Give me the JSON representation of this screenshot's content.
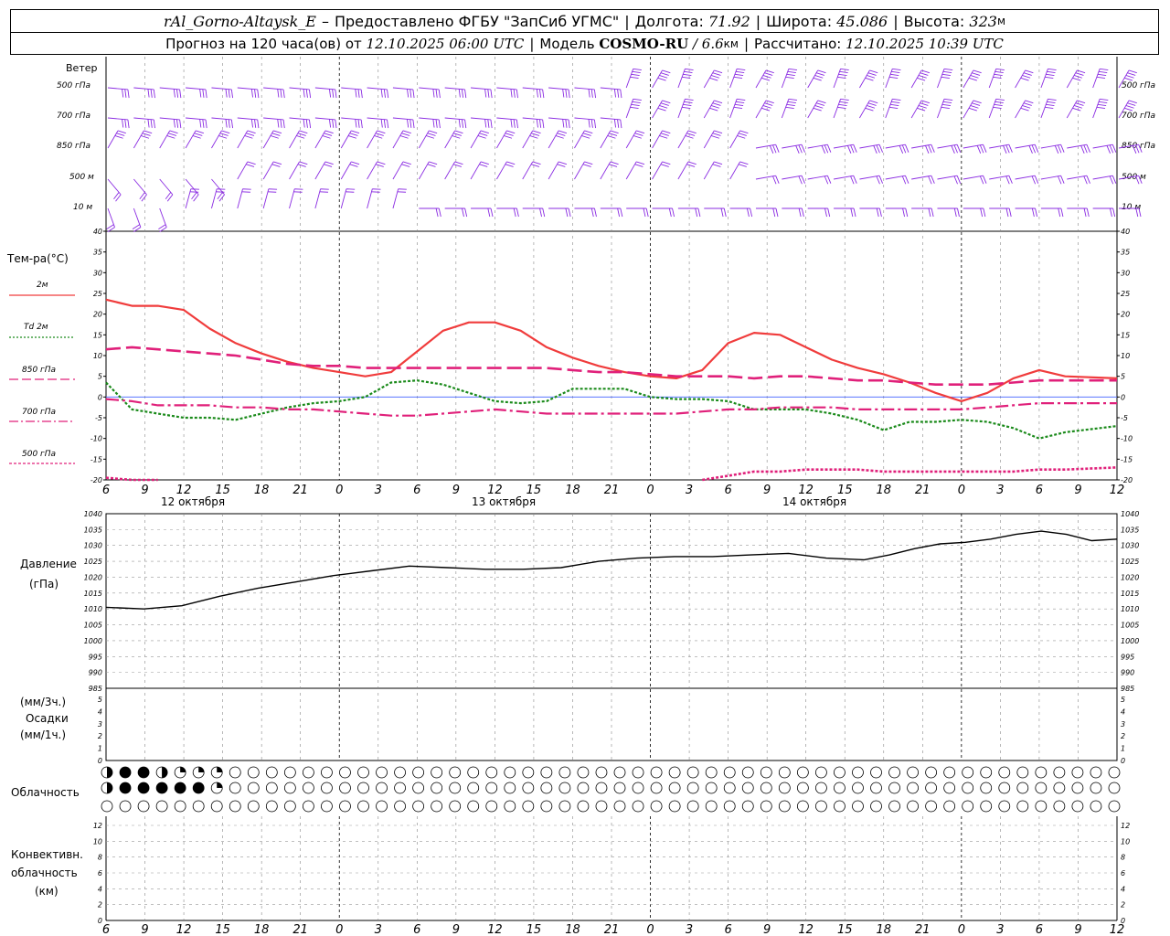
{
  "header": {
    "station": "rAl_Gorno-Altaysk_E",
    "dash": "–",
    "provided_by": "Предоставлено ФГБУ \"ЗапСиб УГМС\"",
    "lon_label": "Долгота:",
    "lon_value": "71.92",
    "lat_label": "Широта:",
    "lat_value": "45.086",
    "alt_label": "Высота:",
    "alt_value": "323",
    "alt_unit": "м",
    "forecast_label": "Прогноз на 120 часа(ов) от",
    "forecast_from": "12.10.2025 06:00 UTC",
    "model_label": "Модель",
    "model_name": "COSMO-RU",
    "model_res": "/ 6.6",
    "model_res_unit": "км",
    "calc_label": "Рассчитано:",
    "calc_value": "12.10.2025 10:39 UTC"
  },
  "wind_panel": {
    "title": "Ветер",
    "levels": [
      "500 гПа",
      "700 гПа",
      "850 гПа",
      "500 м",
      "10 м"
    ],
    "barb_color": "#8a2be2"
  },
  "temp_panel": {
    "title": "Тем-ра(°С)",
    "legend": [
      {
        "label": "2м",
        "color": "#f03c3c",
        "style": "solid"
      },
      {
        "label": "Td 2м",
        "color": "#1a8a1a",
        "style": "dotted"
      },
      {
        "label": "850 гПа",
        "color": "#e0207a",
        "style": "dashed"
      },
      {
        "label": "700 гПа",
        "color": "#e0207a",
        "style": "dashdot"
      },
      {
        "label": "500 гПа",
        "color": "#e0207a",
        "style": "dense-dashed"
      }
    ],
    "yticks": [
      "40",
      "35",
      "30",
      "25",
      "20",
      "15",
      "10",
      "5",
      "0",
      "-5",
      "-10",
      "-15",
      "-20"
    ]
  },
  "time_axis": {
    "hours": [
      "6",
      "9",
      "12",
      "15",
      "18",
      "21",
      "0",
      "3",
      "6",
      "9",
      "12",
      "15",
      "18",
      "21",
      "0",
      "3",
      "6",
      "9",
      "12",
      "15",
      "18",
      "21",
      "0",
      "3",
      "6",
      "9",
      "12"
    ],
    "dates": [
      "12 октября",
      "13 октября",
      "14 октября"
    ]
  },
  "pressure_panel": {
    "title": "Давление",
    "unit": "(гПа)",
    "yticks": [
      "1040",
      "1035",
      "1030",
      "1025",
      "1020",
      "1015",
      "1010",
      "1005",
      "1000",
      "995",
      "990",
      "985"
    ]
  },
  "precip_panel": {
    "unit3": "(мм/3ч.)",
    "title": "Осадки",
    "unit1": "(мм/1ч.)",
    "yticks": [
      "5",
      "4",
      "3",
      "2",
      "1",
      "0"
    ]
  },
  "cloud_panel": {
    "title": "Облачность",
    "rows": [
      [
        2,
        4,
        4,
        2,
        1,
        1,
        1,
        0,
        0,
        0,
        0,
        0,
        0,
        0,
        0,
        0,
        0,
        0,
        0,
        0,
        0,
        0,
        0,
        0,
        0,
        0,
        0,
        0,
        0,
        0,
        0,
        0,
        0,
        0,
        0,
        0,
        0,
        0,
        0,
        0,
        0,
        0,
        0,
        0,
        0,
        0,
        0,
        0,
        0,
        0,
        0,
        0,
        0,
        0,
        0,
        0
      ],
      [
        2,
        4,
        4,
        4,
        4,
        4,
        1,
        0,
        0,
        0,
        0,
        0,
        0,
        0,
        0,
        0,
        0,
        0,
        0,
        0,
        0,
        0,
        0,
        0,
        0,
        0,
        0,
        0,
        0,
        0,
        0,
        0,
        0,
        0,
        0,
        0,
        0,
        0,
        0,
        0,
        0,
        0,
        0,
        0,
        0,
        0,
        0,
        0,
        0,
        0,
        0,
        0,
        0,
        0,
        0,
        0
      ],
      [
        0,
        0,
        0,
        0,
        0,
        0,
        0,
        0,
        0,
        0,
        0,
        0,
        0,
        0,
        0,
        0,
        0,
        0,
        0,
        0,
        0,
        0,
        0,
        0,
        0,
        0,
        0,
        0,
        0,
        0,
        0,
        0,
        0,
        0,
        0,
        0,
        0,
        0,
        0,
        0,
        0,
        0,
        0,
        0,
        0,
        0,
        0,
        0,
        0,
        0,
        0,
        0,
        0,
        0,
        0,
        0
      ]
    ]
  },
  "conv_panel": {
    "title1": "Конвективн.",
    "title2": "облачность",
    "unit": "(км)",
    "yticks": [
      "12",
      "10",
      "8",
      "6",
      "4",
      "2",
      "0"
    ]
  },
  "chart_data": [
    {
      "type": "line",
      "title": "Тем-ра(°С)",
      "x_hours": [
        0,
        3,
        6,
        9,
        12,
        15,
        18,
        21,
        24,
        27,
        30,
        33,
        36,
        39,
        42,
        45,
        48,
        51,
        54,
        57,
        60,
        63,
        66,
        69,
        72,
        75,
        78
      ],
      "ylim": [
        -20,
        40
      ],
      "series": [
        {
          "name": "2м",
          "values": [
            23.5,
            22,
            22,
            21,
            16.5,
            13,
            10.5,
            8.5,
            7,
            6,
            5,
            6,
            11,
            16,
            18,
            18,
            16,
            12,
            9.5,
            7.5,
            6,
            5,
            4.5,
            6.5,
            13,
            15.5,
            15,
            12,
            9,
            7,
            5.5,
            3.5,
            1,
            -1,
            1,
            4.5,
            6.5,
            5,
            4.5
          ]
        },
        {
          "name": "Td 2м",
          "values": [
            3.5,
            -3,
            -4,
            -5,
            -5,
            -5.5,
            -4,
            -2.5,
            -1.5,
            -1,
            0,
            3.5,
            4,
            3,
            1,
            -1,
            -1.5,
            -1,
            2,
            2,
            2,
            0,
            -0.5,
            -0.5,
            -1,
            -3,
            -3,
            -3,
            -4,
            -5.5,
            -8,
            -6,
            -6,
            -5.5,
            -6,
            -7.5,
            -10,
            -8.5,
            -7
          ]
        },
        {
          "name": "850 гПа",
          "values": [
            11.5,
            12,
            11.5,
            11,
            10.5,
            10,
            9,
            8,
            7.5,
            7.5,
            7,
            7,
            7,
            7,
            7,
            7,
            7,
            7,
            6.5,
            6,
            6,
            5.5,
            5,
            5,
            5,
            4.5,
            5,
            5,
            4.5,
            4,
            4,
            3.5,
            3,
            3,
            3,
            3.5,
            4,
            4,
            4
          ]
        },
        {
          "name": "700 гПа",
          "values": [
            -0.5,
            -1,
            -2,
            -2,
            -2,
            -2.5,
            -2.5,
            -3,
            -3,
            -3.5,
            -4,
            -4.5,
            -4.5,
            -4,
            -3.5,
            -3,
            -3.5,
            -4,
            -4,
            -4,
            -4,
            -4,
            -4,
            -3.5,
            -3,
            -3,
            -2.5,
            -2.5,
            -2.5,
            -3,
            -3,
            -3,
            -3,
            -3,
            -2.5,
            -2,
            -1.5,
            -1.5,
            -1.5
          ]
        },
        {
          "name": "500 гПа",
          "values": [
            -19.5,
            -20,
            -20,
            null,
            null,
            null,
            null,
            null,
            null,
            null,
            null,
            null,
            null,
            null,
            null,
            null,
            null,
            null,
            null,
            null,
            null,
            null,
            null,
            -20,
            -19,
            -18,
            -18,
            -17.5,
            -17.5,
            -17.5,
            -18,
            -18,
            -18,
            -18,
            -18,
            -18,
            -17.5,
            -17.5,
            -17
          ]
        }
      ],
      "x_series_hours": [
        0,
        2,
        4,
        6,
        8,
        10,
        12,
        14,
        16,
        18,
        20,
        22,
        24,
        26,
        28,
        30,
        32,
        34,
        36,
        38,
        40,
        42,
        44,
        46,
        48,
        50,
        52,
        54,
        56,
        58,
        60,
        62,
        64,
        66,
        68,
        70,
        72,
        74,
        78
      ]
    },
    {
      "type": "line",
      "title": "Давление",
      "ylabel": "(гПа)",
      "ylim": [
        985,
        1040
      ],
      "x_hours": [
        0,
        3,
        6,
        9,
        12,
        15,
        18,
        21,
        24,
        27,
        30,
        33,
        36,
        39,
        42,
        45,
        48,
        51,
        54,
        57,
        60,
        63,
        66,
        69,
        72,
        75,
        78
      ],
      "series": [
        {
          "name": "Давление",
          "values": [
            1010.5,
            1010,
            1011,
            1014,
            1016.5,
            1018.5,
            1020.5,
            1022,
            1023.5,
            1023,
            1022.5,
            1022.5,
            1023,
            1025,
            1026,
            1026.5,
            1026.5,
            1027,
            1027.5,
            1026,
            1025.5,
            1027,
            1029,
            1030.5,
            1031,
            1032,
            1033.5,
            1034.5,
            1033.5,
            1031.5,
            1032
          ]
        }
      ],
      "x_series_hours": [
        0,
        3,
        6,
        9,
        12,
        15,
        18,
        21,
        24,
        27,
        30,
        33,
        36,
        39,
        42,
        45,
        48,
        51,
        54,
        57,
        60,
        62,
        64,
        66,
        68,
        70,
        72,
        74,
        76,
        78,
        80
      ]
    },
    {
      "type": "bar",
      "title": "Осадки",
      "ylim": [
        0,
        5
      ],
      "values": []
    }
  ]
}
